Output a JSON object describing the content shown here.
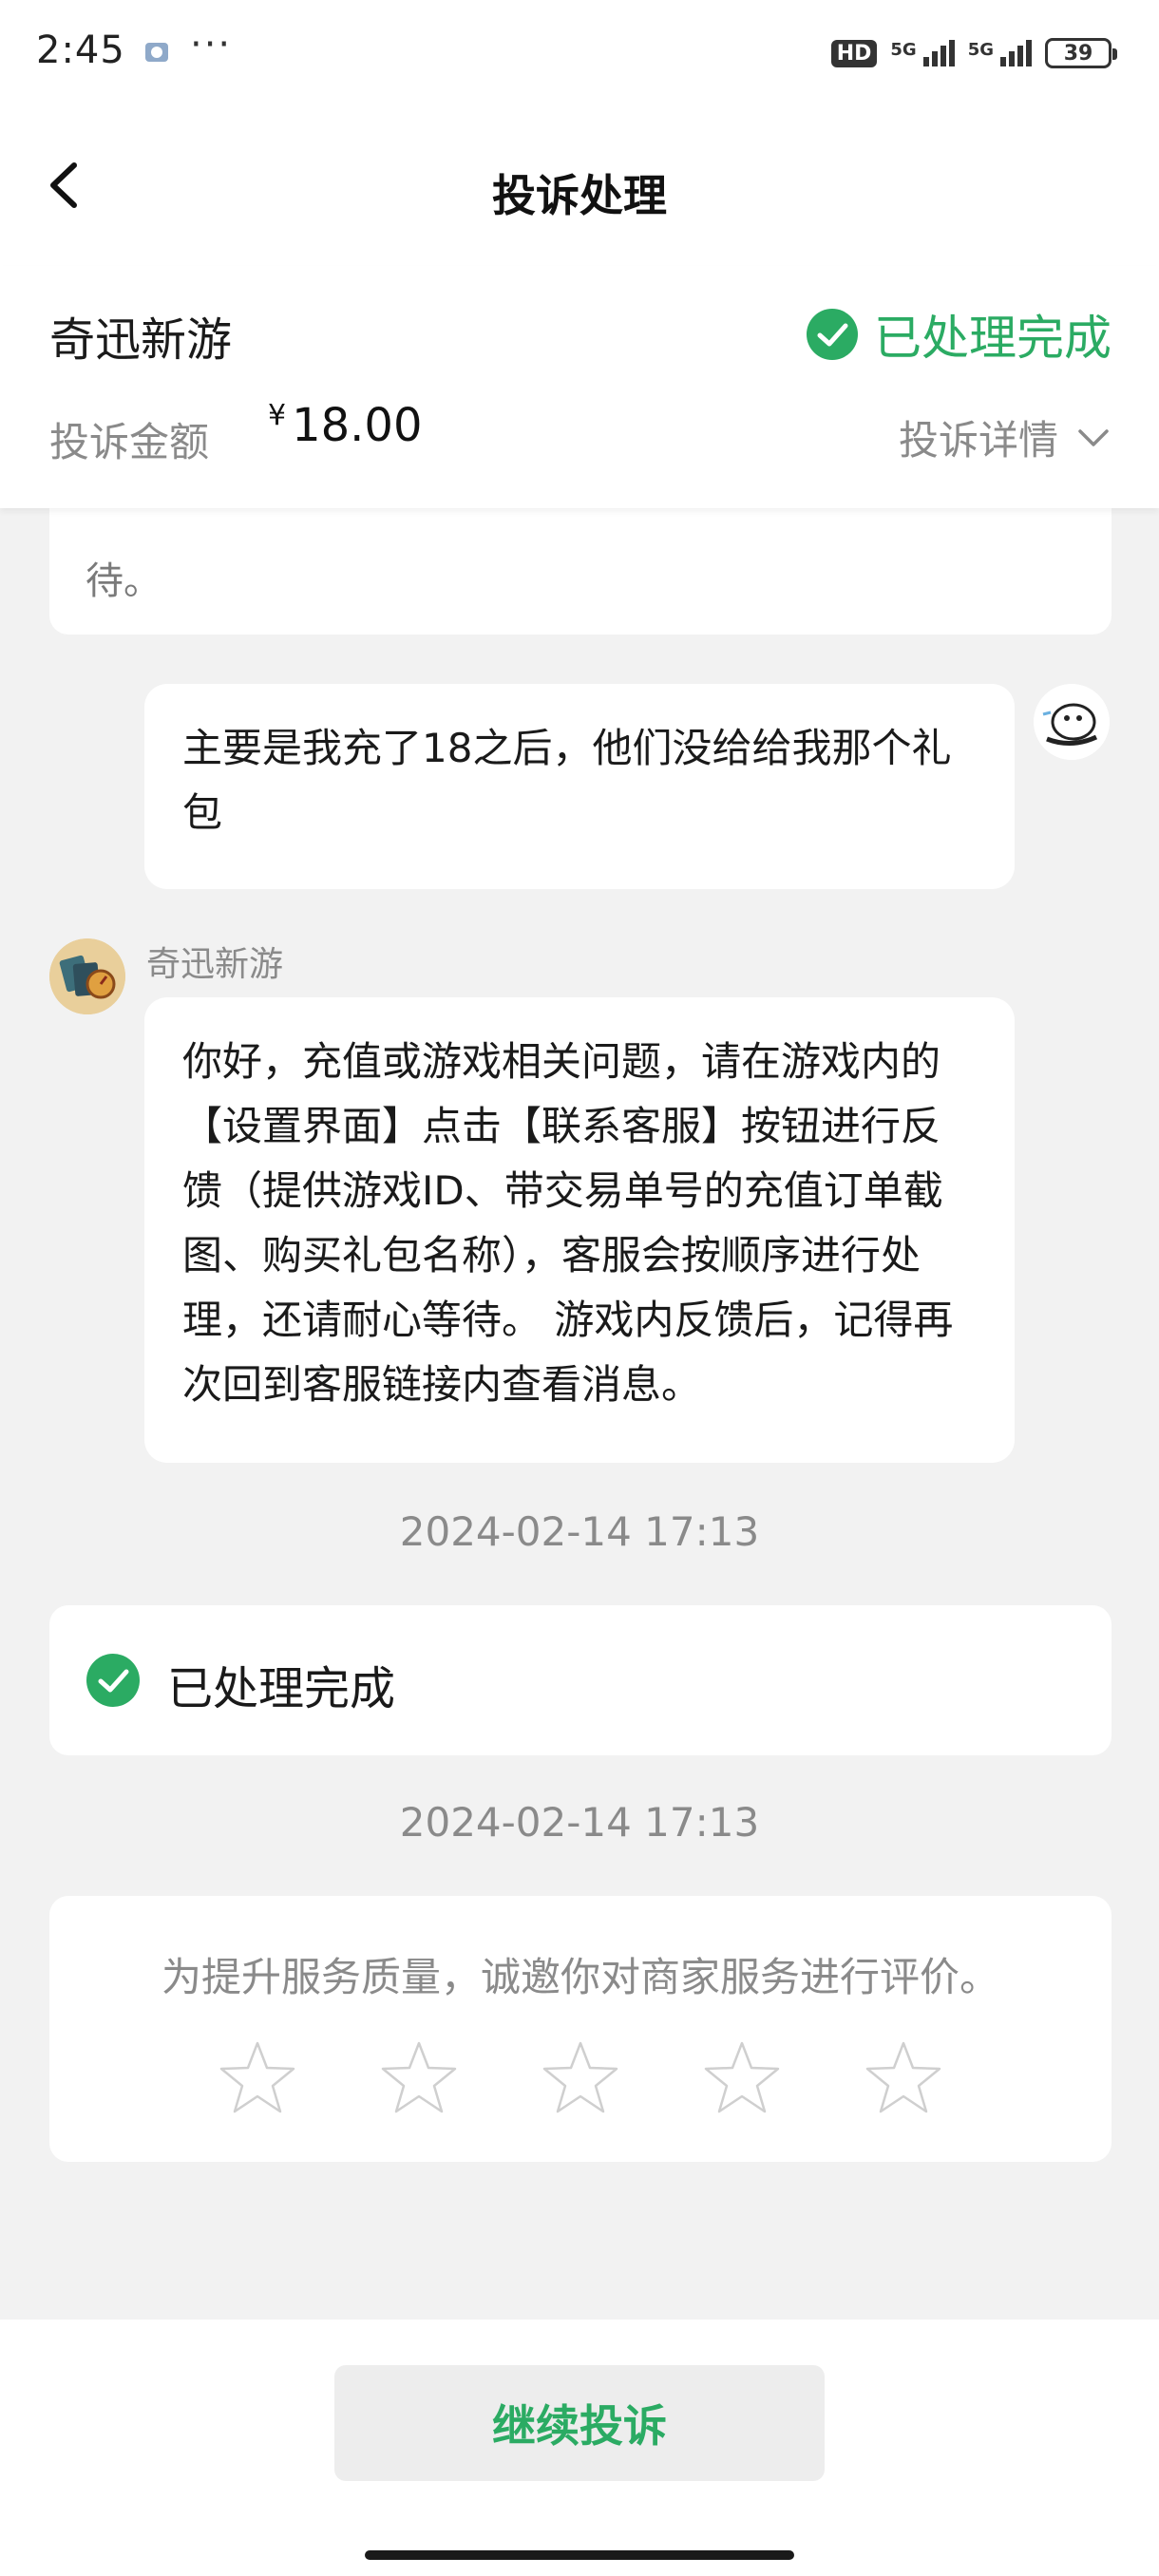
{
  "status_bar": {
    "time": "2:45",
    "dots": "···",
    "hd_label": "HD",
    "network_1": "5G",
    "network_2": "5G",
    "battery": "39"
  },
  "nav": {
    "title": "投诉处理"
  },
  "complaint": {
    "merchant": "奇迅新游",
    "status": "已处理完成",
    "amount_label": "投诉金额",
    "currency": "¥",
    "amount": "18.00",
    "detail_link": "投诉详情",
    "status_color": "#2bab63"
  },
  "messages": {
    "system_text": "待。",
    "user_message": "主要是我充了18之后，他们没给给我那个礼包",
    "merchant_name": "奇迅新游",
    "merchant_message": "你好，充值或游戏相关问题，请在游戏内的【设置界面】点击【联系客服】按钮进行反馈（提供游戏ID、带交易单号的充值订单截图、购买礼包名称），客服会按顺序进行处理，还请耐心等待。 游戏内反馈后，记得再次回到客服链接内查看消息。"
  },
  "timeline": {
    "time_1": "2024-02-14 17:13",
    "done_text": "已处理完成",
    "time_2": "2024-02-14 17:13"
  },
  "rating": {
    "prompt": "为提升服务质量，诚邀你对商家服务进行评价。",
    "stars_selected": 0,
    "stars_total": 5
  },
  "bottom": {
    "continue_label": "继续投诉"
  },
  "colors": {
    "accent": "#2bab63",
    "background": "#f2f2f2"
  }
}
